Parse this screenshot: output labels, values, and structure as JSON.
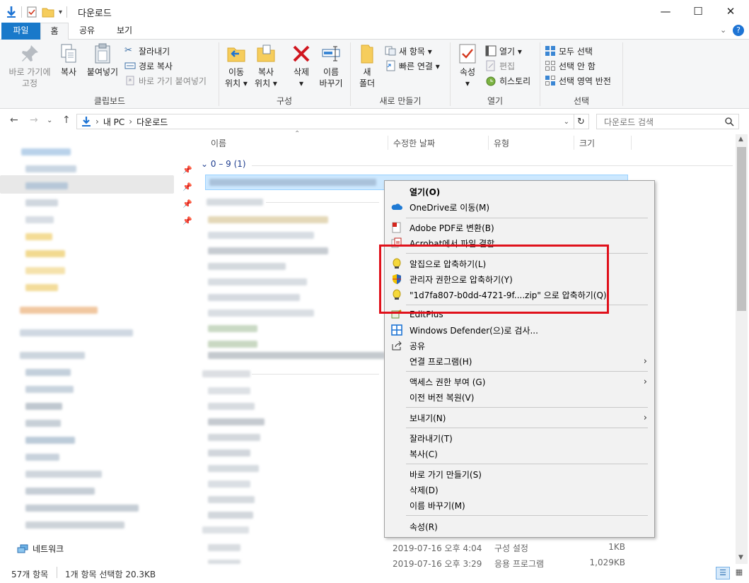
{
  "window": {
    "title": "다운로드",
    "minimize": "—",
    "maximize": "☐",
    "close": "✕"
  },
  "ribbon_tabs": [
    "파일",
    "홈",
    "공유",
    "보기"
  ],
  "ribbon": {
    "pin_label_1": "바로 가기에",
    "pin_label_2": "고정",
    "copy": "복사",
    "paste": "붙여넣기",
    "cut": "잘라내기",
    "copy_path": "경로 복사",
    "paste_shortcut": "바로 가기 붙여넣기",
    "clipboard": "클립보드",
    "move_1": "이동",
    "move_2": "위치 ▾",
    "copyto_1": "복사",
    "copyto_2": "위치 ▾",
    "delete": "삭제",
    "delete_arrow": "▾",
    "rename_1": "이름",
    "rename_2": "바꾸기",
    "organize": "구성",
    "newfolder_1": "새",
    "newfolder_2": "폴더",
    "new_item": "새 항목 ▾",
    "easy_access": "빠른 연결 ▾",
    "new_group": "새로 만들기",
    "properties": "속성",
    "properties_arrow": "▾",
    "open": "열기 ▾",
    "edit": "편집",
    "history": "히스토리",
    "open_group": "열기",
    "select_all": "모두 선택",
    "select_none": "선택 안 함",
    "invert": "선택 영역 반전",
    "select_group": "선택"
  },
  "address": {
    "path_root": "내 PC",
    "path_leaf": "다운로드",
    "separator": "›",
    "search_placeholder": "다운로드 검색"
  },
  "columns": [
    "이름",
    "수정한 날짜",
    "유형",
    "크기"
  ],
  "group_header": "0 – 9 (1)",
  "visible_rows": [
    {
      "date": "2019-07-16 오후 4:04",
      "type": "구성 설정",
      "size": "1KB"
    },
    {
      "date": "2019-07-16 오후 3:29",
      "type": "응용 프로그램",
      "size": "1,029KB"
    }
  ],
  "network_label": "네트워크",
  "status": {
    "count": "57개 항목",
    "selected": "1개 항목 선택함 20.3KB"
  },
  "context_menu": {
    "open": "열기(O)",
    "onedrive": "OneDrive로 이동(M)",
    "adobe_pdf": "Adobe PDF로 변환(B)",
    "acrobat_combine": "Acrobat에서 파일 결합...",
    "alzip": "알집으로 압축하기(L)",
    "alzip_admin": "관리자 권한으로 압축하기(Y)",
    "alzip_named": "\"1d7fa807-b0dd-4721-9f....zip\" 으로 압축하기(Q)",
    "editplus": "EditPlus",
    "defender": "Windows Defender(으)로 검사...",
    "share": "공유",
    "open_with": "연결 프로그램(H)",
    "give_access": "액세스 권한 부여 (G)",
    "restore": "이전 버전 복원(V)",
    "send_to": "보내기(N)",
    "cut": "잘라내기(T)",
    "copy": "복사(C)",
    "create_shortcut": "바로 가기 만들기(S)",
    "delete": "삭제(D)",
    "rename": "이름 바꾸기(M)",
    "properties": "속성(R)",
    "arrow": "›"
  },
  "colors": {
    "accent": "#1979ca",
    "highlight_box": "#e0111b",
    "ribbon_bg": "#f5f6f7",
    "menu_bg": "#f2f2f2"
  }
}
